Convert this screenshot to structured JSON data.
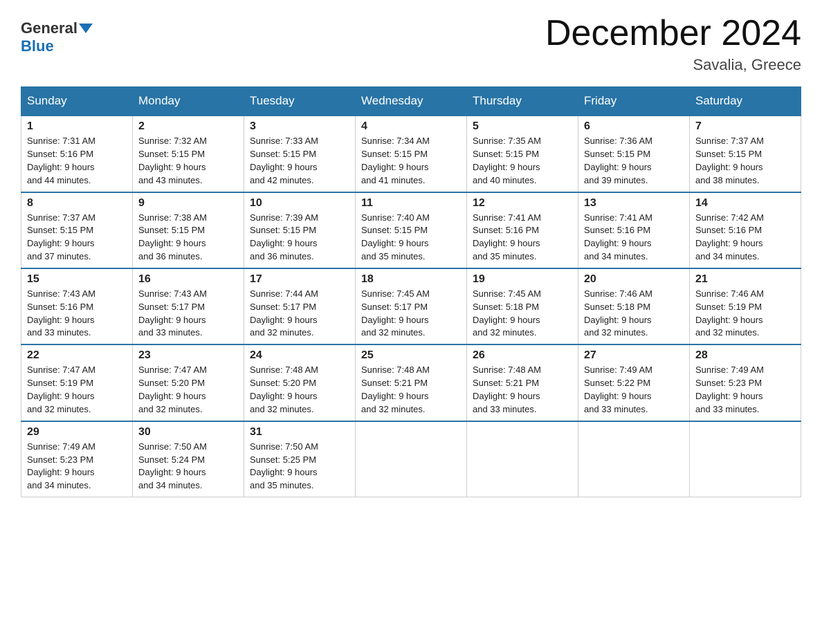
{
  "header": {
    "logo": {
      "general": "General",
      "blue": "Blue"
    },
    "title": "December 2024",
    "subtitle": "Savalia, Greece"
  },
  "weekdays": [
    "Sunday",
    "Monday",
    "Tuesday",
    "Wednesday",
    "Thursday",
    "Friday",
    "Saturday"
  ],
  "weeks": [
    [
      {
        "day": "1",
        "sunrise": "7:31 AM",
        "sunset": "5:16 PM",
        "daylight": "9 hours and 44 minutes."
      },
      {
        "day": "2",
        "sunrise": "7:32 AM",
        "sunset": "5:15 PM",
        "daylight": "9 hours and 43 minutes."
      },
      {
        "day": "3",
        "sunrise": "7:33 AM",
        "sunset": "5:15 PM",
        "daylight": "9 hours and 42 minutes."
      },
      {
        "day": "4",
        "sunrise": "7:34 AM",
        "sunset": "5:15 PM",
        "daylight": "9 hours and 41 minutes."
      },
      {
        "day": "5",
        "sunrise": "7:35 AM",
        "sunset": "5:15 PM",
        "daylight": "9 hours and 40 minutes."
      },
      {
        "day": "6",
        "sunrise": "7:36 AM",
        "sunset": "5:15 PM",
        "daylight": "9 hours and 39 minutes."
      },
      {
        "day": "7",
        "sunrise": "7:37 AM",
        "sunset": "5:15 PM",
        "daylight": "9 hours and 38 minutes."
      }
    ],
    [
      {
        "day": "8",
        "sunrise": "7:37 AM",
        "sunset": "5:15 PM",
        "daylight": "9 hours and 37 minutes."
      },
      {
        "day": "9",
        "sunrise": "7:38 AM",
        "sunset": "5:15 PM",
        "daylight": "9 hours and 36 minutes."
      },
      {
        "day": "10",
        "sunrise": "7:39 AM",
        "sunset": "5:15 PM",
        "daylight": "9 hours and 36 minutes."
      },
      {
        "day": "11",
        "sunrise": "7:40 AM",
        "sunset": "5:15 PM",
        "daylight": "9 hours and 35 minutes."
      },
      {
        "day": "12",
        "sunrise": "7:41 AM",
        "sunset": "5:16 PM",
        "daylight": "9 hours and 35 minutes."
      },
      {
        "day": "13",
        "sunrise": "7:41 AM",
        "sunset": "5:16 PM",
        "daylight": "9 hours and 34 minutes."
      },
      {
        "day": "14",
        "sunrise": "7:42 AM",
        "sunset": "5:16 PM",
        "daylight": "9 hours and 34 minutes."
      }
    ],
    [
      {
        "day": "15",
        "sunrise": "7:43 AM",
        "sunset": "5:16 PM",
        "daylight": "9 hours and 33 minutes."
      },
      {
        "day": "16",
        "sunrise": "7:43 AM",
        "sunset": "5:17 PM",
        "daylight": "9 hours and 33 minutes."
      },
      {
        "day": "17",
        "sunrise": "7:44 AM",
        "sunset": "5:17 PM",
        "daylight": "9 hours and 32 minutes."
      },
      {
        "day": "18",
        "sunrise": "7:45 AM",
        "sunset": "5:17 PM",
        "daylight": "9 hours and 32 minutes."
      },
      {
        "day": "19",
        "sunrise": "7:45 AM",
        "sunset": "5:18 PM",
        "daylight": "9 hours and 32 minutes."
      },
      {
        "day": "20",
        "sunrise": "7:46 AM",
        "sunset": "5:18 PM",
        "daylight": "9 hours and 32 minutes."
      },
      {
        "day": "21",
        "sunrise": "7:46 AM",
        "sunset": "5:19 PM",
        "daylight": "9 hours and 32 minutes."
      }
    ],
    [
      {
        "day": "22",
        "sunrise": "7:47 AM",
        "sunset": "5:19 PM",
        "daylight": "9 hours and 32 minutes."
      },
      {
        "day": "23",
        "sunrise": "7:47 AM",
        "sunset": "5:20 PM",
        "daylight": "9 hours and 32 minutes."
      },
      {
        "day": "24",
        "sunrise": "7:48 AM",
        "sunset": "5:20 PM",
        "daylight": "9 hours and 32 minutes."
      },
      {
        "day": "25",
        "sunrise": "7:48 AM",
        "sunset": "5:21 PM",
        "daylight": "9 hours and 32 minutes."
      },
      {
        "day": "26",
        "sunrise": "7:48 AM",
        "sunset": "5:21 PM",
        "daylight": "9 hours and 33 minutes."
      },
      {
        "day": "27",
        "sunrise": "7:49 AM",
        "sunset": "5:22 PM",
        "daylight": "9 hours and 33 minutes."
      },
      {
        "day": "28",
        "sunrise": "7:49 AM",
        "sunset": "5:23 PM",
        "daylight": "9 hours and 33 minutes."
      }
    ],
    [
      {
        "day": "29",
        "sunrise": "7:49 AM",
        "sunset": "5:23 PM",
        "daylight": "9 hours and 34 minutes."
      },
      {
        "day": "30",
        "sunrise": "7:50 AM",
        "sunset": "5:24 PM",
        "daylight": "9 hours and 34 minutes."
      },
      {
        "day": "31",
        "sunrise": "7:50 AM",
        "sunset": "5:25 PM",
        "daylight": "9 hours and 35 minutes."
      },
      null,
      null,
      null,
      null
    ]
  ],
  "labels": {
    "sunrise": "Sunrise: ",
    "sunset": "Sunset: ",
    "daylight": "Daylight: "
  }
}
